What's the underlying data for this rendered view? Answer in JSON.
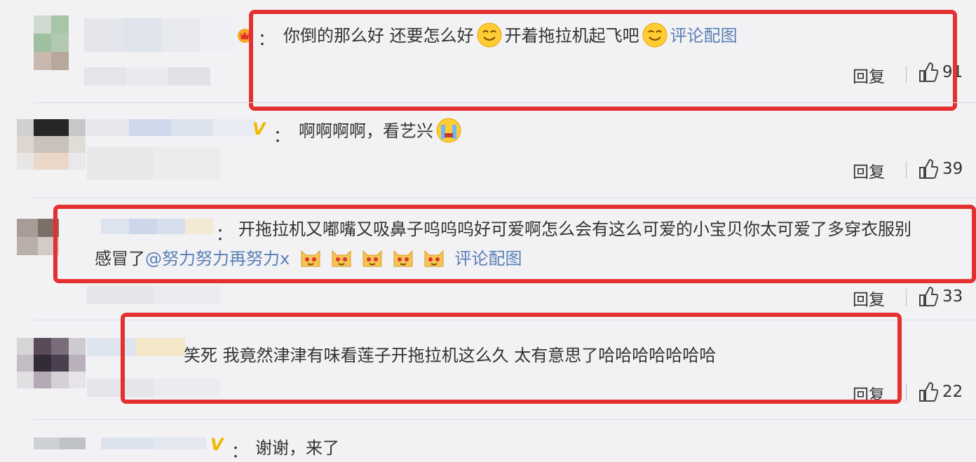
{
  "comments": [
    {
      "text_a": "你倒的那么好 还要怎么好",
      "text_b": "开着拖拉机起飞吧",
      "link": "评论配图",
      "reply": "回复",
      "likes": "91"
    },
    {
      "text_a": "啊啊啊啊，看艺兴",
      "reply": "回复",
      "likes": "39"
    },
    {
      "text_a": "开拖拉机又嘟嘴又吸鼻子呜呜呜好可爱啊怎么会有这么可爱的小宝贝你太可爱了多穿衣服别",
      "text_b": "感冒了",
      "mention": "@努力努力再努力x",
      "link": "评论配图",
      "reply": "回复",
      "likes": "33"
    },
    {
      "text_a": "笑死 我竟然津津有味看莲子开拖拉机这么久 太有意思了哈哈哈哈哈哈哈",
      "reply": "回复",
      "likes": "22"
    },
    {
      "text_a": "谢谢，来了"
    }
  ],
  "colon": "：",
  "icons": {
    "like": "thumbs-up-icon",
    "v_badge": "verified-v-icon",
    "crown": "crown-icon",
    "smile": "smile-emoji",
    "cry": "crying-emoji",
    "cat": "cat-emoji"
  },
  "colors": {
    "highlight": "#e53030",
    "link": "#5b7fb5",
    "v_badge": "#f0b800"
  }
}
